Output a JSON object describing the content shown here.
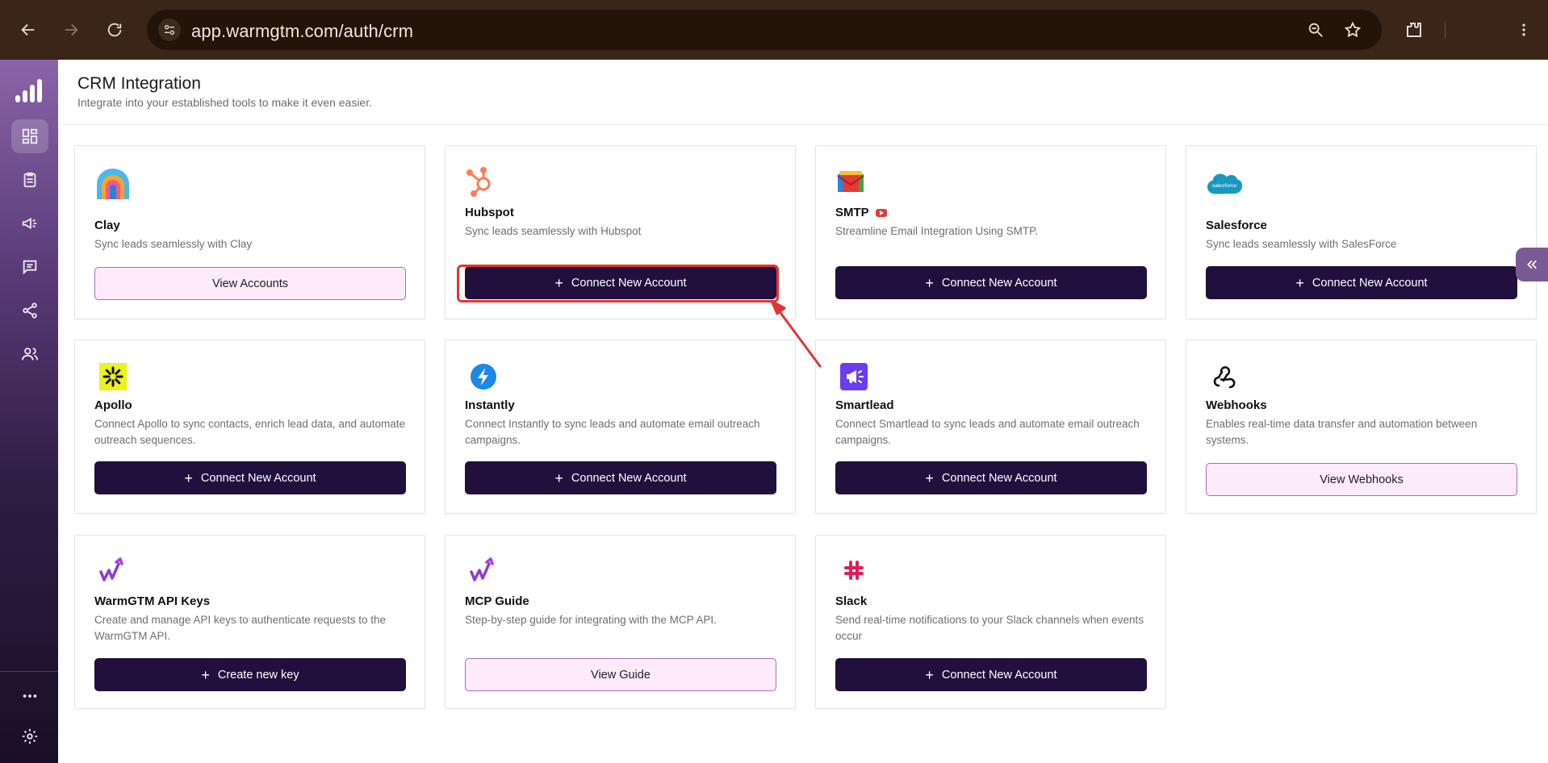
{
  "browser": {
    "url": "app.warmgtm.com/auth/crm"
  },
  "page": {
    "title": "CRM Integration",
    "subtitle": "Integrate into your established tools to make it even easier."
  },
  "cards": {
    "clay": {
      "title": "Clay",
      "desc": "Sync leads seamlessly with Clay",
      "button": "View Accounts"
    },
    "hubspot": {
      "title": "Hubspot",
      "desc": "Sync leads seamlessly with Hubspot",
      "button": "Connect New Account"
    },
    "smtp": {
      "title": "SMTP",
      "desc": "Streamline Email Integration Using SMTP.",
      "button": "Connect New Account"
    },
    "salesforce": {
      "title": "Salesforce",
      "desc": "Sync leads seamlessly with SalesForce",
      "button": "Connect New Account",
      "logo_text": "salesforce"
    },
    "apollo": {
      "title": "Apollo",
      "desc": "Connect Apollo to sync contacts, enrich lead data, and automate outreach sequences.",
      "button": "Connect New Account"
    },
    "instantly": {
      "title": "Instantly",
      "desc": "Connect Instantly to sync leads and automate email outreach campaigns.",
      "button": "Connect New Account"
    },
    "smartlead": {
      "title": "Smartlead",
      "desc": "Connect Smartlead to sync leads and automate email outreach campaigns.",
      "button": "Connect New Account"
    },
    "webhooks": {
      "title": "Webhooks",
      "desc": "Enables real-time data transfer and automation between systems.",
      "button": "View Webhooks"
    },
    "apikeys": {
      "title": "WarmGTM API Keys",
      "desc": "Create and manage API keys to authenticate requests to the WarmGTM API.",
      "button": "Create new key"
    },
    "mcp": {
      "title": "MCP Guide",
      "desc": "Step-by-step guide for integrating with the MCP API.",
      "button": "View Guide"
    },
    "slack": {
      "title": "Slack",
      "desc": "Send real-time notifications to your Slack channels when events occur",
      "button": "Connect New Account"
    }
  },
  "colors": {
    "primary_button": "#21103d",
    "outline_button_bg": "#fdebfb",
    "outline_button_border": "#a271b4",
    "highlight": "#e33434",
    "chrome_bg": "#3b2418"
  },
  "icons": {
    "sidebar": [
      "dashboard-icon",
      "clipboard-icon",
      "megaphone-icon",
      "messages-icon",
      "share-icon",
      "users-icon",
      "more-icon",
      "settings-icon"
    ]
  }
}
